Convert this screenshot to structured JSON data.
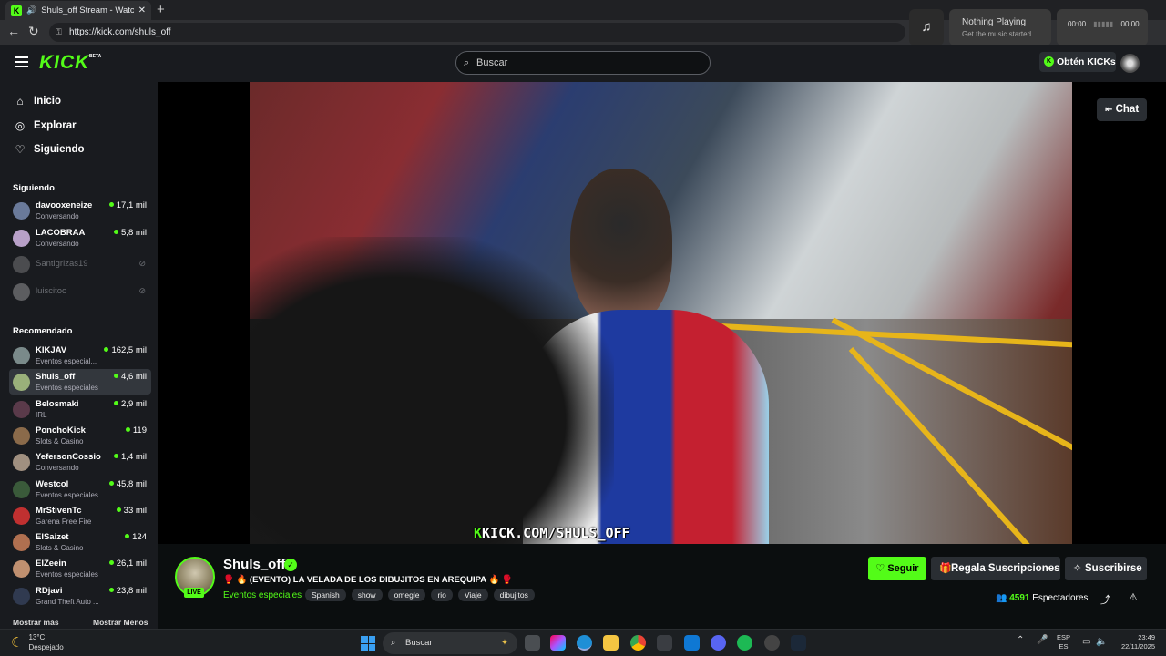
{
  "browser": {
    "tab_title": "Shuls_off Stream - Watch Liv",
    "url": "https://kick.com/shuls_off"
  },
  "media_widget": {
    "title": "Nothing Playing",
    "subtitle": "Get the music started",
    "time_start": "00:00",
    "time_end": "00:00"
  },
  "header": {
    "logo": "KICK",
    "badge": "BETA",
    "search_placeholder": "Buscar",
    "get_kicks": "Obtén KICKs"
  },
  "sidebar": {
    "nav": [
      {
        "label": "Inicio",
        "icon": "home-icon"
      },
      {
        "label": "Explorar",
        "icon": "compass-icon"
      },
      {
        "label": "Siguiendo",
        "icon": "heart-icon"
      }
    ],
    "following_header": "Siguiendo",
    "following": [
      {
        "name": "davooxeneize",
        "category": "Conversando",
        "viewers": "17,1 mil",
        "avatar_color": "#6a7a9a"
      },
      {
        "name": "LACOBRAA",
        "category": "Conversando",
        "viewers": "5,8 mil",
        "avatar_color": "#b8a0c8"
      },
      {
        "name": "Santigrizas19",
        "avatar_color": "#8a8a8a"
      },
      {
        "name": "luiscitoo",
        "avatar_color": "#b0b0b0"
      }
    ],
    "recommended_header": "Recomendado",
    "recommended": [
      {
        "name": "KIKJAV",
        "category": "Eventos especial...",
        "viewers": "162,5 mil",
        "avatar_color": "#7a8a8a"
      },
      {
        "name": "Shuls_off",
        "category": "Eventos especiales",
        "viewers": "4,6 mil",
        "avatar_color": "#9ab07a"
      },
      {
        "name": "Belosmaki",
        "category": "IRL",
        "viewers": "2,9 mil",
        "avatar_color": "#5a3a4a"
      },
      {
        "name": "PonchoKick",
        "category": "Slots & Casino",
        "viewers": "119",
        "avatar_color": "#8a6a4a"
      },
      {
        "name": "YefersonCossio",
        "category": "Conversando",
        "viewers": "1,4 mil",
        "avatar_color": "#a09080"
      },
      {
        "name": "Westcol",
        "category": "Eventos especiales",
        "viewers": "45,8 mil",
        "avatar_color": "#3a5a3a"
      },
      {
        "name": "MrStivenTc",
        "category": "Garena Free Fire",
        "viewers": "33 mil",
        "avatar_color": "#c03030"
      },
      {
        "name": "ElSaizet",
        "category": "Slots & Casino",
        "viewers": "124",
        "avatar_color": "#b07050"
      },
      {
        "name": "ElZeein",
        "category": "Eventos especiales",
        "viewers": "26,1 mil",
        "avatar_color": "#c09070"
      },
      {
        "name": "RDjavi",
        "category": "Grand Theft Auto ...",
        "viewers": "23,8 mil",
        "avatar_color": "#303a50"
      }
    ],
    "show_more": "Mostrar más",
    "show_less": "Mostrar Menos"
  },
  "player": {
    "watermark_k": "K",
    "watermark_text": "KICK.COM/SHULS_OFF",
    "chat_button": "Chat"
  },
  "stream": {
    "streamer": "Shuls_off",
    "live_badge": "LIVE",
    "title": "🥊 🔥 (EVENTO) LA VELADA DE LOS DIBUJITOS EN AREQUIPA 🔥 🥊",
    "category": "Eventos especiales",
    "tags": [
      "Spanish",
      "show",
      "omegle",
      "rio",
      "Viaje",
      "dibujitos"
    ],
    "follow_button": "Seguir",
    "gift_button": "Regala Suscripciones",
    "subscribe_button": "Suscribirse",
    "viewer_count": "4591",
    "viewer_label": "Espectadores"
  },
  "taskbar": {
    "temperature": "13°C",
    "weather": "Despejado",
    "search": "Buscar",
    "lang_top": "ESP",
    "lang_bottom": "ES",
    "time": "23:49",
    "date": "22/11/2025"
  },
  "colors": {
    "kick_green": "#53fc18",
    "panel": "#191b1f",
    "background": "#0b0e0f"
  }
}
